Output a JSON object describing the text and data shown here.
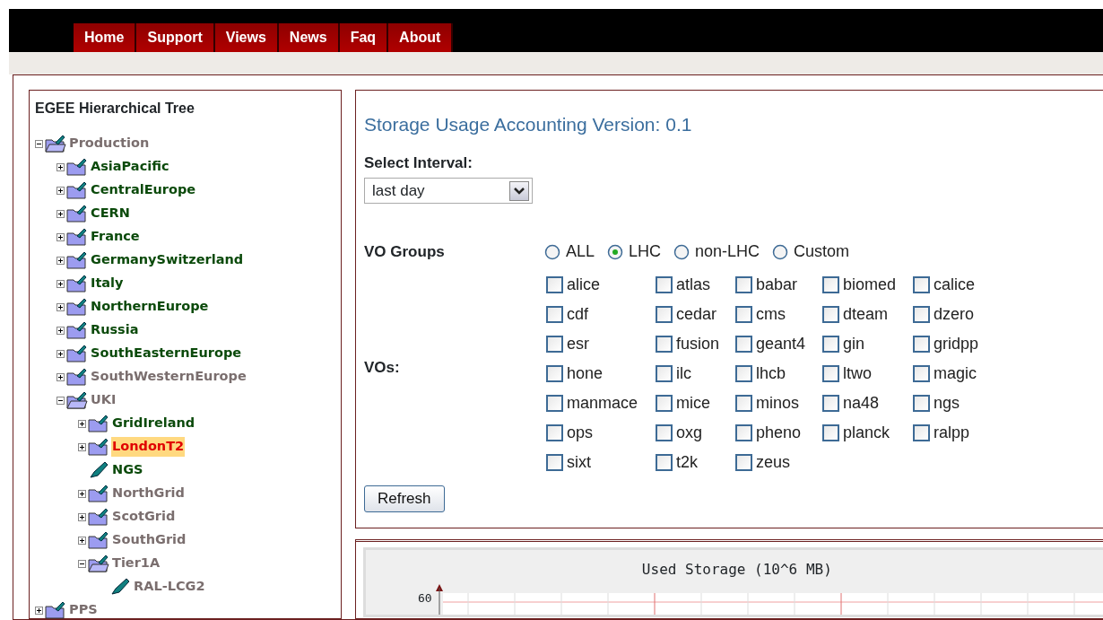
{
  "nav": {
    "tabs": [
      {
        "label": "Home",
        "selected": false
      },
      {
        "label": "Support",
        "selected": false
      },
      {
        "label": "Views",
        "selected": false
      },
      {
        "label": "News",
        "selected": false
      },
      {
        "label": "Faq",
        "selected": false
      },
      {
        "label": "About",
        "selected": false
      }
    ]
  },
  "tree": {
    "title": "EGEE Hierarchical Tree",
    "nodes": [
      {
        "label": "Production",
        "kind": "folder",
        "color": "#7a6e6e",
        "selected": false,
        "expanded": true,
        "children": [
          {
            "label": "AsiaPacific",
            "kind": "folder",
            "color": "#0b4a0b",
            "selected": false,
            "expanded": false
          },
          {
            "label": "CentralEurope",
            "kind": "folder",
            "color": "#0b4a0b",
            "selected": false,
            "expanded": false
          },
          {
            "label": "CERN",
            "kind": "folder",
            "color": "#0b4a0b",
            "selected": false,
            "expanded": false
          },
          {
            "label": "France",
            "kind": "folder",
            "color": "#0b4a0b",
            "selected": false,
            "expanded": false
          },
          {
            "label": "GermanySwitzerland",
            "kind": "folder",
            "color": "#0b4a0b",
            "selected": false,
            "expanded": false
          },
          {
            "label": "Italy",
            "kind": "folder",
            "color": "#0b4a0b",
            "selected": false,
            "expanded": false
          },
          {
            "label": "NorthernEurope",
            "kind": "folder",
            "color": "#0b4a0b",
            "selected": false,
            "expanded": false
          },
          {
            "label": "Russia",
            "kind": "folder",
            "color": "#0b4a0b",
            "selected": false,
            "expanded": false
          },
          {
            "label": "SouthEasternEurope",
            "kind": "folder",
            "color": "#0b4a0b",
            "selected": false,
            "expanded": false
          },
          {
            "label": "SouthWesternEurope",
            "kind": "folder",
            "color": "#7a6e6e",
            "selected": false,
            "expanded": false
          },
          {
            "label": "UKI",
            "kind": "folder",
            "color": "#7a6e6e",
            "selected": false,
            "expanded": true,
            "children": [
              {
                "label": "GridIreland",
                "kind": "folder",
                "color": "#0b4a0b",
                "selected": false,
                "expanded": false
              },
              {
                "label": "LondonT2",
                "kind": "folder",
                "selected": true,
                "expanded": false
              },
              {
                "label": "NGS",
                "kind": "leaf",
                "color": "#0b4a0b",
                "selected": false
              },
              {
                "label": "NorthGrid",
                "kind": "folder",
                "color": "#7a6e6e",
                "selected": false,
                "expanded": false
              },
              {
                "label": "ScotGrid",
                "kind": "folder",
                "color": "#7a6e6e",
                "selected": false,
                "expanded": false
              },
              {
                "label": "SouthGrid",
                "kind": "folder",
                "color": "#7a6e6e",
                "selected": false,
                "expanded": false
              },
              {
                "label": "Tier1A",
                "kind": "folder",
                "color": "#7a6e6e",
                "selected": false,
                "expanded": true,
                "children": [
                  {
                    "label": "RAL-LCG2",
                    "kind": "leaf",
                    "color": "#7a6e6e",
                    "selected": false
                  }
                ]
              }
            ]
          }
        ]
      },
      {
        "label": "PPS",
        "kind": "folder",
        "color": "#7a6e6e",
        "selected": false,
        "expanded": false
      }
    ]
  },
  "form": {
    "title": "Storage Usage Accounting Version: 0.1",
    "interval_label": "Select Interval:",
    "interval_value": "last day",
    "groups_label": "VO Groups",
    "groups": [
      {
        "label": "ALL",
        "selected": false
      },
      {
        "label": "LHC",
        "selected": true
      },
      {
        "label": "non-LHC",
        "selected": false
      },
      {
        "label": "Custom",
        "selected": false
      }
    ],
    "vos_label": "VOs:",
    "vos": [
      {
        "label": "alice",
        "checked": false
      },
      {
        "label": "atlas",
        "checked": false
      },
      {
        "label": "babar",
        "checked": false
      },
      {
        "label": "biomed",
        "checked": false
      },
      {
        "label": "calice",
        "checked": false
      },
      {
        "label": "cdf",
        "checked": false
      },
      {
        "label": "cedar",
        "checked": false
      },
      {
        "label": "cms",
        "checked": false
      },
      {
        "label": "dteam",
        "checked": false
      },
      {
        "label": "dzero",
        "checked": false
      },
      {
        "label": "esr",
        "checked": false
      },
      {
        "label": "fusion",
        "checked": false
      },
      {
        "label": "geant4",
        "checked": false
      },
      {
        "label": "gin",
        "checked": false
      },
      {
        "label": "gridpp",
        "checked": false
      },
      {
        "label": "hone",
        "checked": false
      },
      {
        "label": "ilc",
        "checked": false
      },
      {
        "label": "lhcb",
        "checked": false
      },
      {
        "label": "ltwo",
        "checked": false
      },
      {
        "label": "magic",
        "checked": false
      },
      {
        "label": "manmace",
        "checked": false
      },
      {
        "label": "mice",
        "checked": false
      },
      {
        "label": "minos",
        "checked": false
      },
      {
        "label": "na48",
        "checked": false
      },
      {
        "label": "ngs",
        "checked": false
      },
      {
        "label": "ops",
        "checked": false
      },
      {
        "label": "oxg",
        "checked": false
      },
      {
        "label": "pheno",
        "checked": false
      },
      {
        "label": "planck",
        "checked": false
      },
      {
        "label": "ralpp",
        "checked": false
      },
      {
        "label": "sixt",
        "checked": false
      },
      {
        "label": "t2k",
        "checked": false
      },
      {
        "label": "zeus",
        "checked": false
      }
    ],
    "refresh_button": "Refresh"
  },
  "chart": {
    "title": "Used Storage (10^6 MB)",
    "y_tick": "60"
  }
}
